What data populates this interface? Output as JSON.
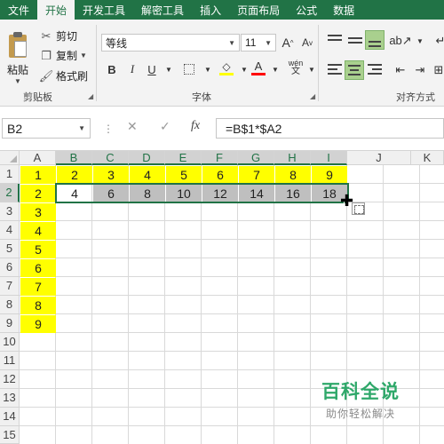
{
  "menu": {
    "tabs": [
      "文件",
      "开始",
      "开发工具",
      "解密工具",
      "插入",
      "页面布局",
      "公式",
      "数据"
    ],
    "active_tab": "开始",
    "brand_color": "#217346"
  },
  "ribbon": {
    "clipboard": {
      "paste_label": "粘贴",
      "cut_label": "剪切",
      "copy_label": "复制",
      "format_painter_label": "格式刷",
      "group_label": "剪贴板"
    },
    "font": {
      "font_name": "等线",
      "font_size": "11",
      "grow_label": "A",
      "shrink_label": "A",
      "bold_label": "B",
      "italic_label": "I",
      "underline_label": "U",
      "phonetic_label": "wén",
      "group_label": "字体"
    },
    "alignment": {
      "group_label": "对齐方式"
    }
  },
  "formula_bar": {
    "name_box": "B2",
    "cancel_icon": "close-icon",
    "enter_icon": "check-icon",
    "fx_label": "fx",
    "formula": "=B$1*$A2"
  },
  "sheet": {
    "columns": [
      "A",
      "B",
      "C",
      "D",
      "E",
      "F",
      "G",
      "H",
      "I",
      "J",
      "K"
    ],
    "rows": [
      "1",
      "2",
      "3",
      "4",
      "5",
      "6",
      "7",
      "8",
      "9",
      "10",
      "11",
      "12",
      "13",
      "14",
      "15"
    ],
    "selected_column_range": [
      "B",
      "I"
    ],
    "selected_row": "2",
    "highlight_color": "#ffff00",
    "selection_fill_color": "#bfbfbf",
    "row1_values": [
      "1",
      "2",
      "3",
      "4",
      "5",
      "6",
      "7",
      "8",
      "9"
    ],
    "colA_values": [
      "1",
      "2",
      "3",
      "4",
      "5",
      "6",
      "7",
      "8",
      "9"
    ],
    "row2_values": [
      "4",
      "6",
      "8",
      "10",
      "12",
      "14",
      "16",
      "18"
    ]
  },
  "watermark": {
    "title": "百科全说",
    "subtitle": "助你轻松解决"
  }
}
